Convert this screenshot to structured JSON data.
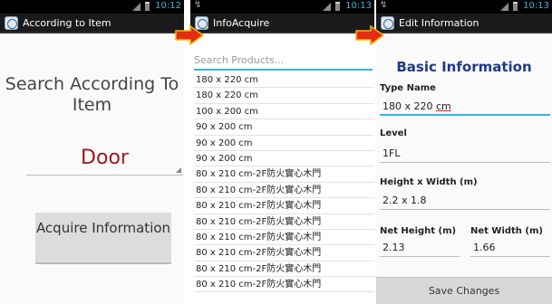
{
  "screens": [
    {
      "status_time": "10:12",
      "title": "According to Item",
      "search_label": "Search According To Item",
      "selected_item": "Door",
      "button_label": "Acquire Information"
    },
    {
      "status_time": "10:13",
      "title": "InfoAcquire",
      "search_placeholder": "Search Products...",
      "items": [
        "180 x 220 cm",
        "180 x 220 cm",
        "100 x 200 cm",
        "90 x 200 cm",
        "90 x 200 cm",
        "90 x 200 cm",
        "80 x 210 cm-2F防火實心木門",
        "80 x 210 cm-2F防火實心木門",
        "80 x 210 cm-2F防火實心木門",
        "80 x 210 cm-2F防火實心木門",
        "80 x 210 cm-2F防火實心木門",
        "80 x 210 cm-2F防火實心木門",
        "80 x 210 cm-2F防火實心木門",
        "80 x 210 cm-2F防火實心木門"
      ]
    },
    {
      "status_time": "10:13",
      "title": "Edit Information",
      "heading": "Basic Information",
      "type_name_label": "Type Name",
      "type_name_value": "180 x 220",
      "type_name_unit": "cm",
      "level_label": "Level",
      "level_value": "1FL",
      "hw_label": "Height x Width (m)",
      "hw_value": "2.2 x 1.8",
      "net_height_label": "Net Height (m)",
      "net_height_value": "2.13",
      "net_width_label": "Net Width (m)",
      "net_width_value": "1.66",
      "save_label": "Save Changes"
    }
  ],
  "colors": {
    "arrow_fill": "#e52b12",
    "arrow_stroke": "#f3b800",
    "accent": "#33b5e5",
    "heading": "#1f3a8a",
    "selected_item": "#9a1a1a"
  }
}
